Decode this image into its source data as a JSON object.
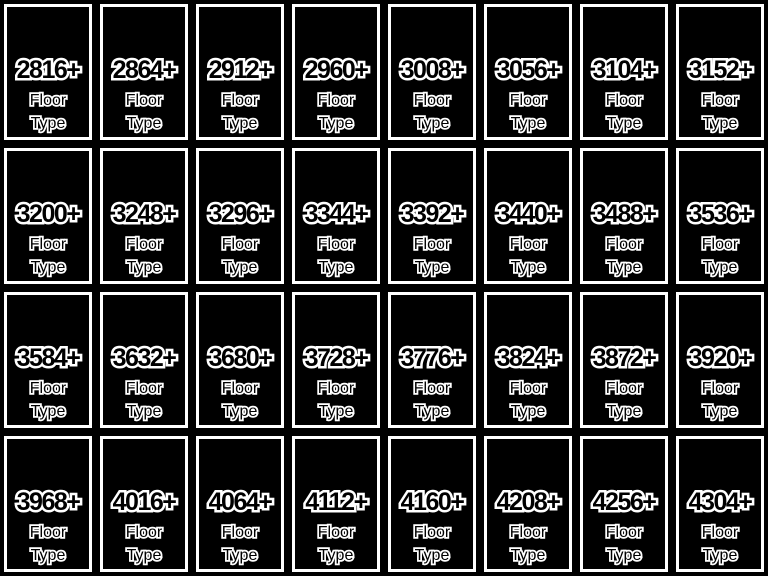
{
  "tile_label_line1": "Floor",
  "tile_label_line2": "Type",
  "colors": {
    "background": "#000000",
    "frame": "#ffffff",
    "text_outline": "#ffffff",
    "text_fill": "#000000"
  },
  "tiles": [
    {
      "value": "2816+"
    },
    {
      "value": "2864+"
    },
    {
      "value": "2912+"
    },
    {
      "value": "2960+"
    },
    {
      "value": "3008+"
    },
    {
      "value": "3056+"
    },
    {
      "value": "3104+"
    },
    {
      "value": "3152+"
    },
    {
      "value": "3200+"
    },
    {
      "value": "3248+"
    },
    {
      "value": "3296+"
    },
    {
      "value": "3344+"
    },
    {
      "value": "3392+"
    },
    {
      "value": "3440+"
    },
    {
      "value": "3488+"
    },
    {
      "value": "3536+"
    },
    {
      "value": "3584+"
    },
    {
      "value": "3632+"
    },
    {
      "value": "3680+"
    },
    {
      "value": "3728+"
    },
    {
      "value": "3776+"
    },
    {
      "value": "3824+"
    },
    {
      "value": "3872+"
    },
    {
      "value": "3920+"
    },
    {
      "value": "3968+"
    },
    {
      "value": "4016+"
    },
    {
      "value": "4064+"
    },
    {
      "value": "4112+"
    },
    {
      "value": "4160+"
    },
    {
      "value": "4208+"
    },
    {
      "value": "4256+"
    },
    {
      "value": "4304+"
    }
  ]
}
